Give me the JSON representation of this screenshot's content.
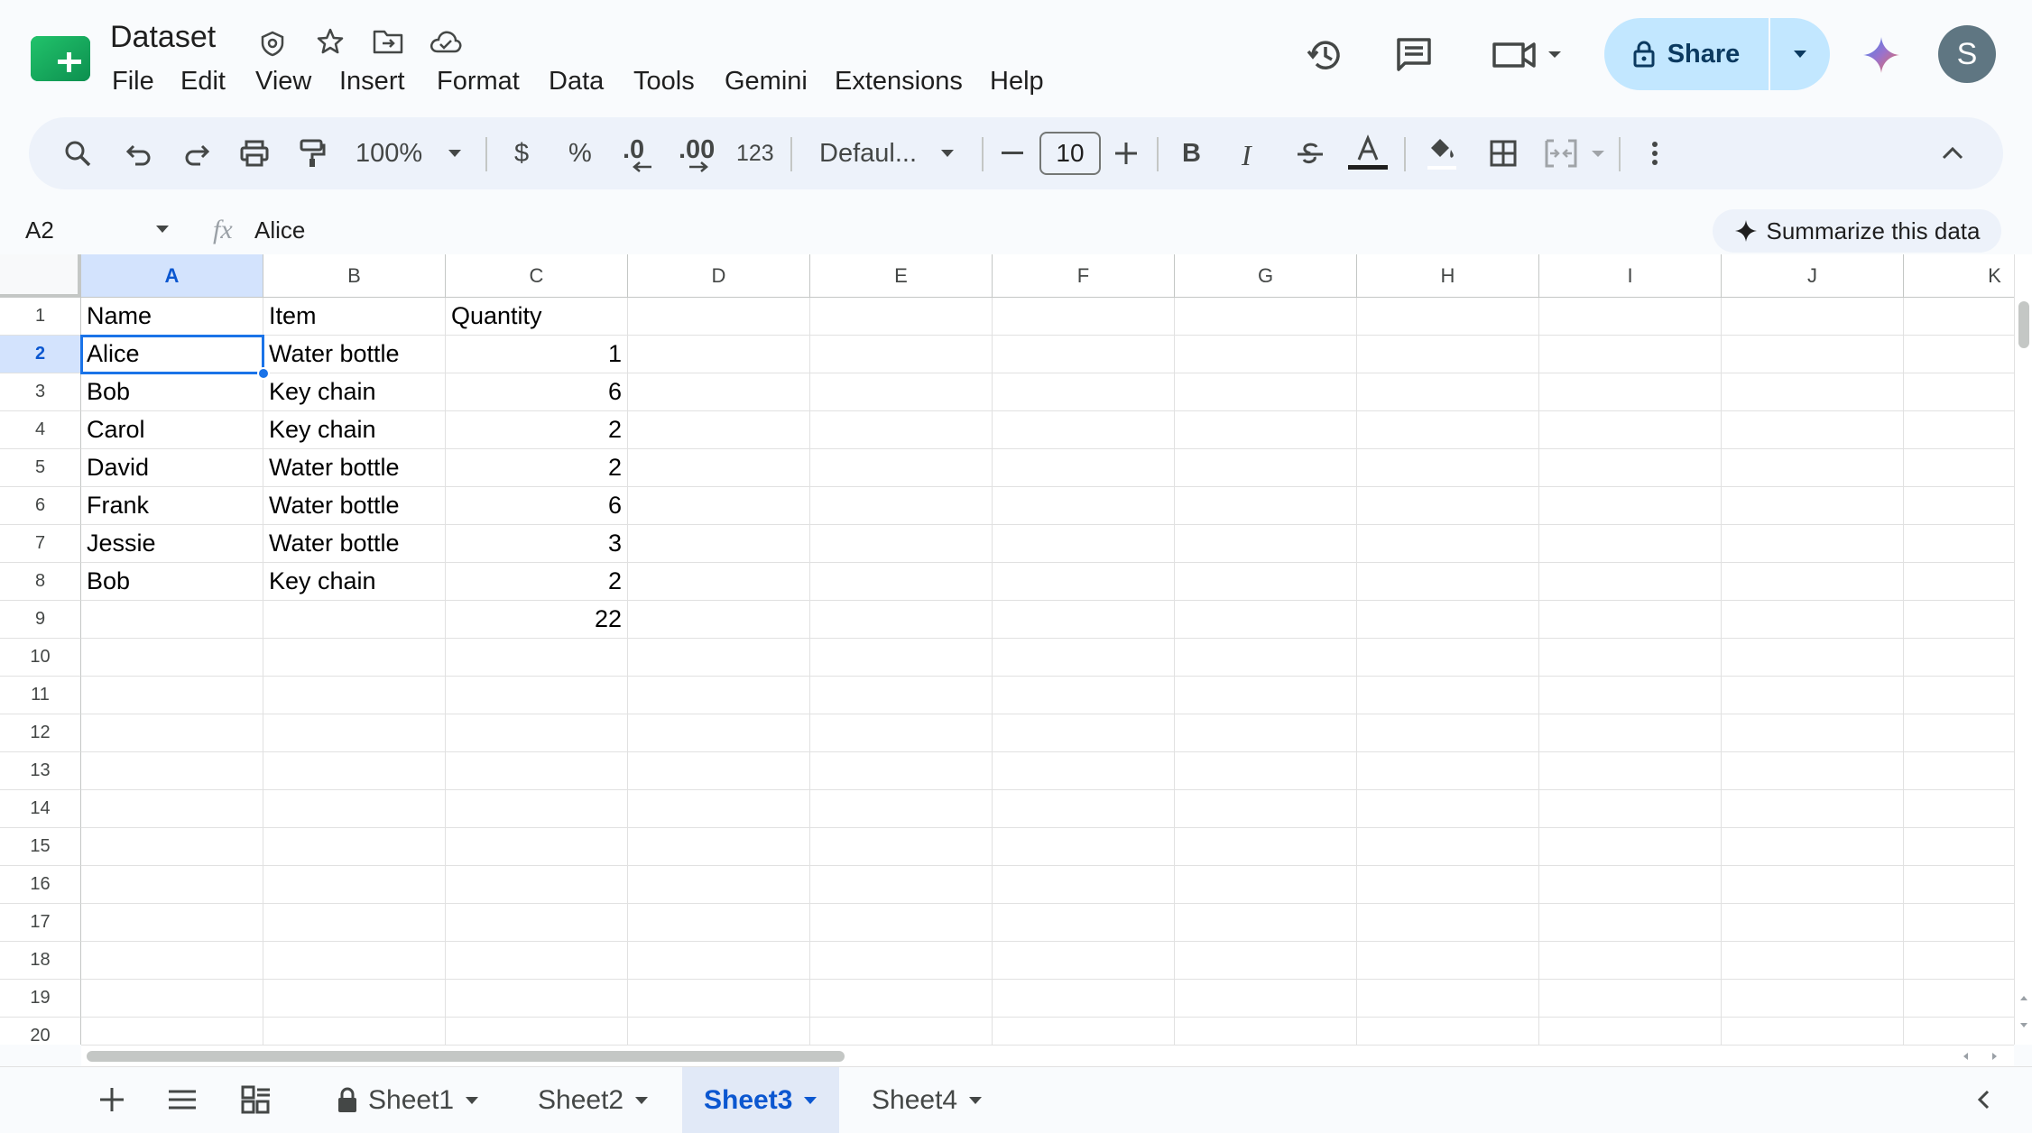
{
  "app": {
    "doc_title": "Dataset",
    "menu": [
      "File",
      "Edit",
      "View",
      "Insert",
      "Format",
      "Data",
      "Tools",
      "Gemini",
      "Extensions",
      "Help"
    ],
    "share_label": "Share",
    "avatar_initial": "S",
    "accent_color": "#0b57d0",
    "share_bg": "#c2e7ff"
  },
  "toolbar": {
    "zoom": "100%",
    "currency": "$",
    "percent": "%",
    "dec_decrease": ".0",
    "dec_increase": ".00",
    "number_format": "123",
    "font": "Defaul...",
    "font_size": "10",
    "bold": "B",
    "italic": "I"
  },
  "formula_bar": {
    "name_box": "A2",
    "fx": "fx",
    "value": "Alice",
    "summarize_label": "Summarize this data"
  },
  "grid": {
    "columns": [
      "A",
      "B",
      "C",
      "D",
      "E",
      "F",
      "G",
      "H",
      "I",
      "J",
      "K"
    ],
    "rows": [
      "1",
      "2",
      "3",
      "4",
      "5",
      "6",
      "7",
      "8",
      "9",
      "10",
      "11",
      "12",
      "13",
      "14",
      "15",
      "16",
      "17",
      "18",
      "19",
      "20"
    ],
    "selected_cell": "A2",
    "data": [
      [
        "Name",
        "Item",
        "Quantity"
      ],
      [
        "Alice",
        "Water bottle",
        "1"
      ],
      [
        "Bob",
        "Key chain",
        "6"
      ],
      [
        "Carol",
        "Key chain",
        "2"
      ],
      [
        "David",
        "Water bottle",
        "2"
      ],
      [
        "Frank",
        "Water bottle",
        "6"
      ],
      [
        "Jessie",
        "Water bottle",
        "3"
      ],
      [
        "Bob",
        "Key chain",
        "2"
      ],
      [
        "",
        "",
        "22"
      ]
    ]
  },
  "sheets": [
    {
      "name": "Sheet1",
      "locked": true,
      "active": false
    },
    {
      "name": "Sheet2",
      "locked": false,
      "active": false
    },
    {
      "name": "Sheet3",
      "locked": false,
      "active": true
    },
    {
      "name": "Sheet4",
      "locked": false,
      "active": false
    }
  ]
}
